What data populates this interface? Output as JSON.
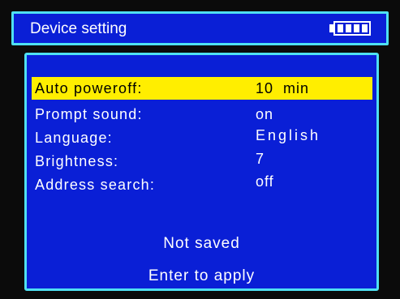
{
  "header": {
    "title": "Device setting",
    "battery_level": 1.0
  },
  "settings": [
    {
      "label": "Auto poweroff:",
      "value": "10  min",
      "selected": true
    },
    {
      "label": "Prompt sound:",
      "value": "on",
      "selected": false
    },
    {
      "label": "Language:",
      "value": "English",
      "selected": false
    },
    {
      "label": "Brightness:",
      "value": "7",
      "selected": false
    },
    {
      "label": "Address search:",
      "value": "off",
      "selected": false
    }
  ],
  "status": {
    "saved_text": "Not saved",
    "apply_text": "Enter to apply"
  },
  "colors": {
    "screen_blue": "#0a1fd6",
    "frame_cyan": "#4fe0f2",
    "highlight_yellow": "#ffee00"
  }
}
